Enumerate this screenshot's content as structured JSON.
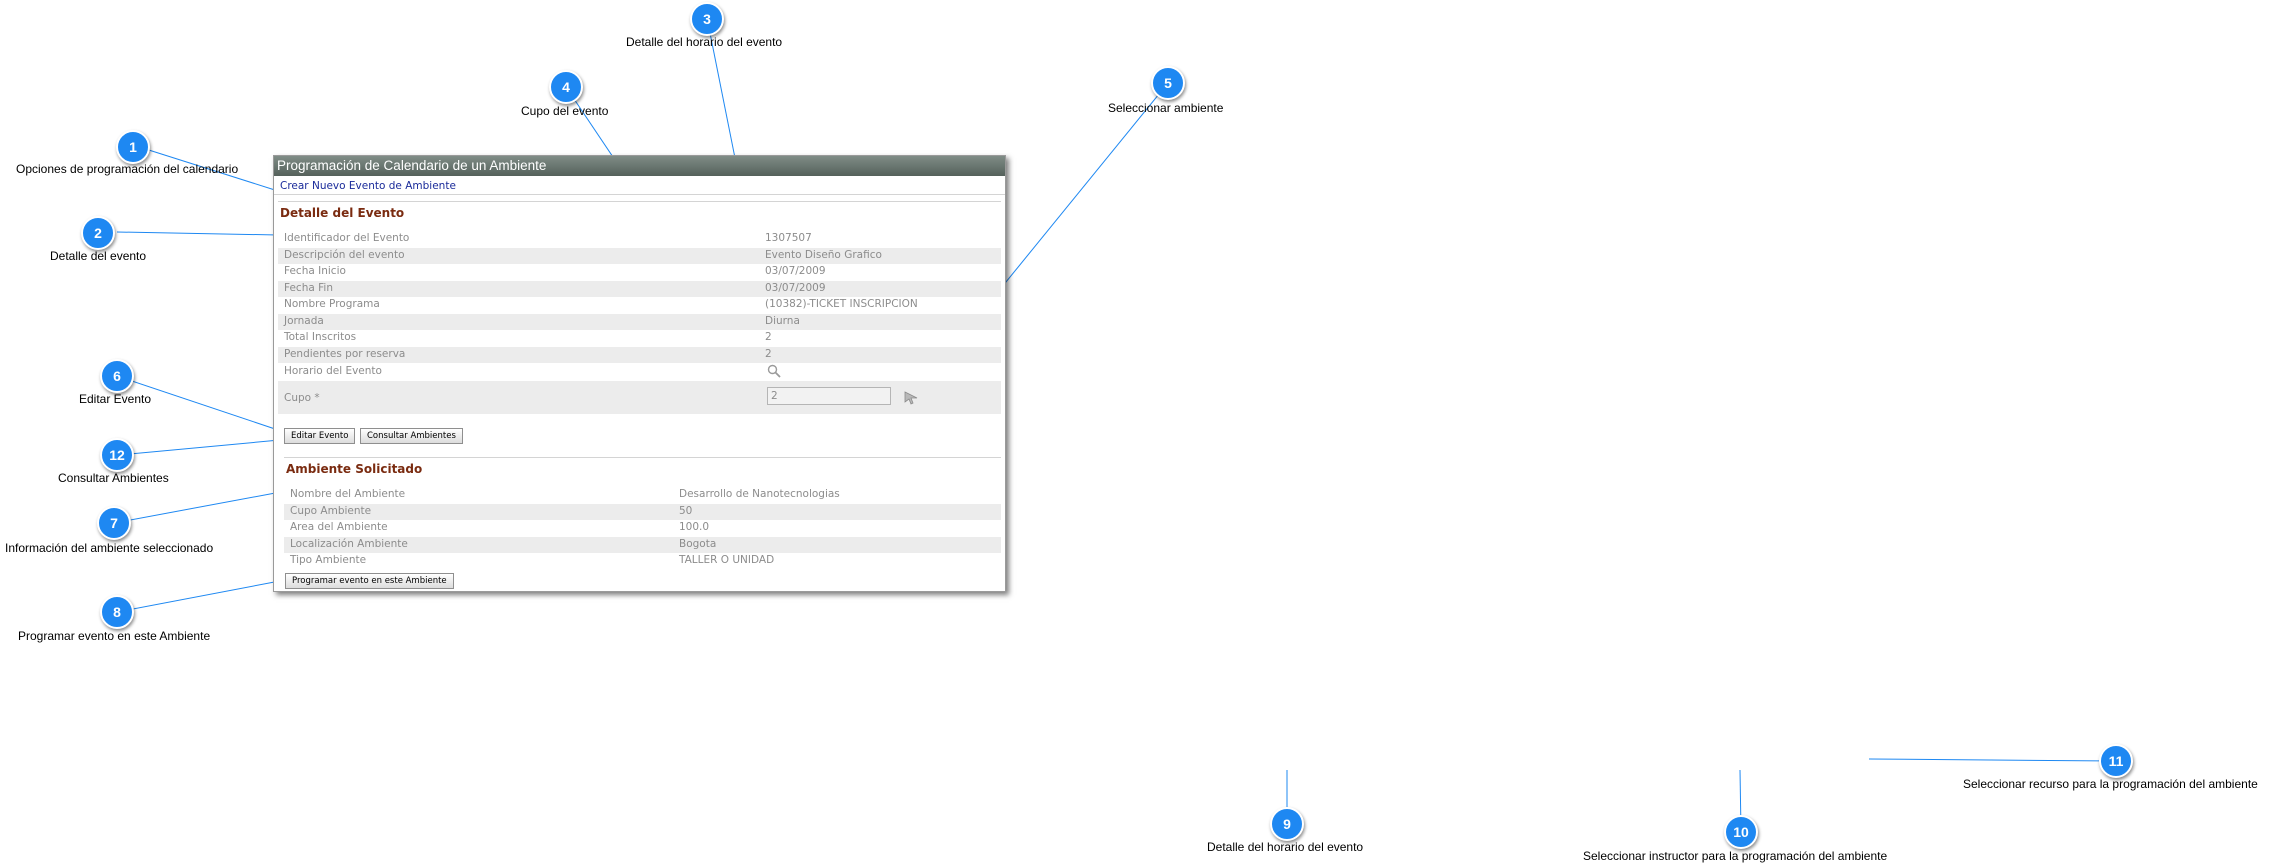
{
  "window": {
    "title": "Programación de Calendario de un Ambiente",
    "new_event_link": "Crear Nuevo Evento de Ambiente"
  },
  "event_detail": {
    "title": "Detalle del Evento",
    "fields": [
      {
        "label": "Identificador del Evento",
        "value": "1307507"
      },
      {
        "label": "Descripción del evento",
        "value": "Evento Diseño Grafico"
      },
      {
        "label": "Fecha Inicio",
        "value": "03/07/2009"
      },
      {
        "label": "Fecha Fin",
        "value": "03/07/2009"
      },
      {
        "label": "Nombre Programa",
        "value": "(10382)-TICKET INSCRIPCION"
      },
      {
        "label": "Jornada",
        "value": "Diurna"
      },
      {
        "label": "Total Inscritos",
        "value": "2"
      },
      {
        "label": "Pendientes por reserva",
        "value": "2"
      },
      {
        "label": "Horario del Evento",
        "value": ""
      }
    ],
    "cupo_label": "Cupo *",
    "cupo_value": "2",
    "edit_button": "Editar Evento",
    "consult_button": "Consultar Ambientes"
  },
  "environment": {
    "title": "Ambiente Solicitado",
    "fields": [
      {
        "label": "Nombre del Ambiente",
        "value": "Desarrollo de Nanotecnologias"
      },
      {
        "label": "Cupo Ambiente",
        "value": "50"
      },
      {
        "label": "Area del Ambiente",
        "value": "100.0"
      },
      {
        "label": "Localización Ambiente",
        "value": "Bogota"
      },
      {
        "label": "Tipo Ambiente",
        "value": "TALLER O UNIDAD"
      }
    ],
    "program_button": "Programar evento en este Ambiente"
  },
  "callouts": [
    {
      "num": "1",
      "label": "Opciones de programación del calendario"
    },
    {
      "num": "2",
      "label": "Detalle del evento"
    },
    {
      "num": "3",
      "label": "Detalle del horario del evento"
    },
    {
      "num": "4",
      "label": "Cupo del evento"
    },
    {
      "num": "5",
      "label": "Seleccionar ambiente"
    },
    {
      "num": "6",
      "label": "Editar Evento"
    },
    {
      "num": "12",
      "label": "Consultar Ambientes"
    },
    {
      "num": "7",
      "label": "Información del ambiente seleccionado"
    },
    {
      "num": "8",
      "label": "Programar evento en este Ambiente"
    },
    {
      "num": "9",
      "label": "Detalle del horario del evento"
    },
    {
      "num": "10",
      "label": "Seleccionar instructor para la programación del ambiente"
    },
    {
      "num": "11",
      "label": "Seleccionar recurso para la programación del ambiente"
    }
  ],
  "colors": {
    "callout": "#1e88f2",
    "header": "#6b7671",
    "section_title": "#7a2b10",
    "link": "#1a2b9a"
  },
  "icons": {
    "schedule": "magnifier-icon",
    "select_environment": "pointer-tool-icon"
  }
}
